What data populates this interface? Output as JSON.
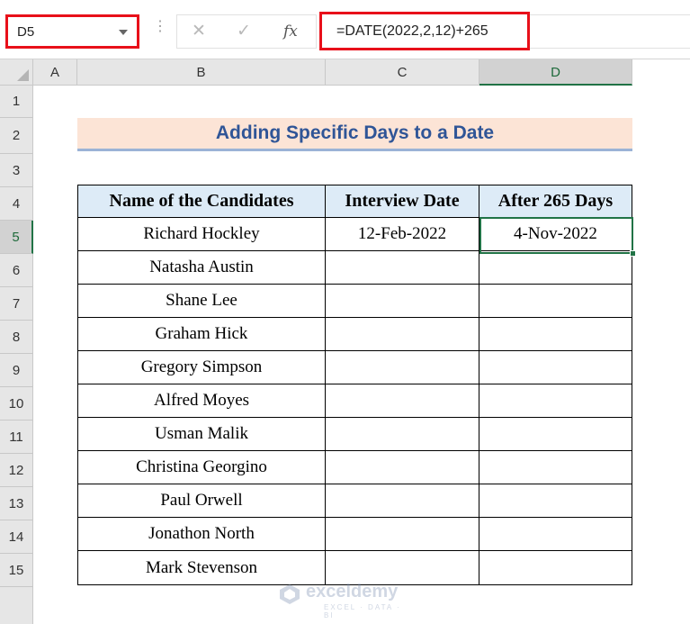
{
  "formula_bar": {
    "name_box": "D5",
    "cancel_icon": "✕",
    "enter_icon": "✓",
    "function_icon": "fx",
    "formula": "=DATE(2022,2,12)+265"
  },
  "columns": [
    "A",
    "B",
    "C",
    "D"
  ],
  "rows": [
    "1",
    "2",
    "3",
    "4",
    "5",
    "6",
    "7",
    "8",
    "9",
    "10",
    "11",
    "12",
    "13",
    "14",
    "15"
  ],
  "selection": {
    "cell": "D5",
    "column": "D",
    "row": "5"
  },
  "sheet": {
    "title": "Adding Specific Days to a Date",
    "headers": [
      "Name of the Candidates",
      "Interview Date",
      "After 265 Days"
    ],
    "rows": [
      [
        "Richard Hockley",
        "12-Feb-2022",
        "4-Nov-2022"
      ],
      [
        "Natasha Austin",
        "",
        ""
      ],
      [
        "Shane Lee",
        "",
        ""
      ],
      [
        "Graham Hick",
        "",
        ""
      ],
      [
        "Gregory Simpson",
        "",
        ""
      ],
      [
        "Alfred Moyes",
        "",
        ""
      ],
      [
        "Usman Malik",
        "",
        ""
      ],
      [
        "Christina Georgino",
        "",
        ""
      ],
      [
        "Paul Orwell",
        "",
        ""
      ],
      [
        "Jonathon North",
        "",
        ""
      ],
      [
        "Mark Stevenson",
        "",
        ""
      ]
    ]
  },
  "watermark": {
    "name": "exceldemy",
    "tagline": "EXCEL · DATA · BI"
  },
  "colors": {
    "highlight_border": "#e8101a",
    "selection_green": "#217346",
    "title_fill": "#fce4d6",
    "title_text": "#2f5597",
    "header_fill": "#ddebf7"
  }
}
